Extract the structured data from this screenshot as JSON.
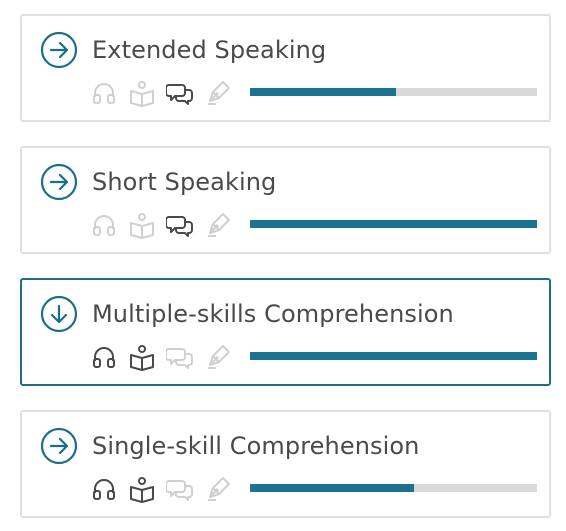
{
  "colors": {
    "accent": "#1a6f86",
    "progress_fill": "#1a7490",
    "progress_track": "#d9d9d9",
    "skill_active": "#4a4a4a",
    "skill_inactive": "#d0d0d0",
    "border": "#e0e0e0"
  },
  "tasks": [
    {
      "title": "Extended Speaking",
      "status_icon": "arrow-right-circle-icon",
      "skills": {
        "listening": false,
        "reading": false,
        "speaking": true,
        "writing": false
      },
      "progress": 0.51
    },
    {
      "title": "Short Speaking",
      "status_icon": "arrow-right-circle-icon",
      "skills": {
        "listening": false,
        "reading": false,
        "speaking": true,
        "writing": false
      },
      "progress": 1.0
    },
    {
      "title": "Multiple-skills Comprehension",
      "status_icon": "arrow-down-circle-icon",
      "selected": true,
      "skills": {
        "listening": true,
        "reading": true,
        "speaking": false,
        "writing": false
      },
      "progress": 1.0
    },
    {
      "title": "Single-skill Comprehension",
      "status_icon": "arrow-right-circle-icon",
      "skills": {
        "listening": true,
        "reading": true,
        "speaking": false,
        "writing": false
      },
      "progress": 0.57
    }
  ]
}
